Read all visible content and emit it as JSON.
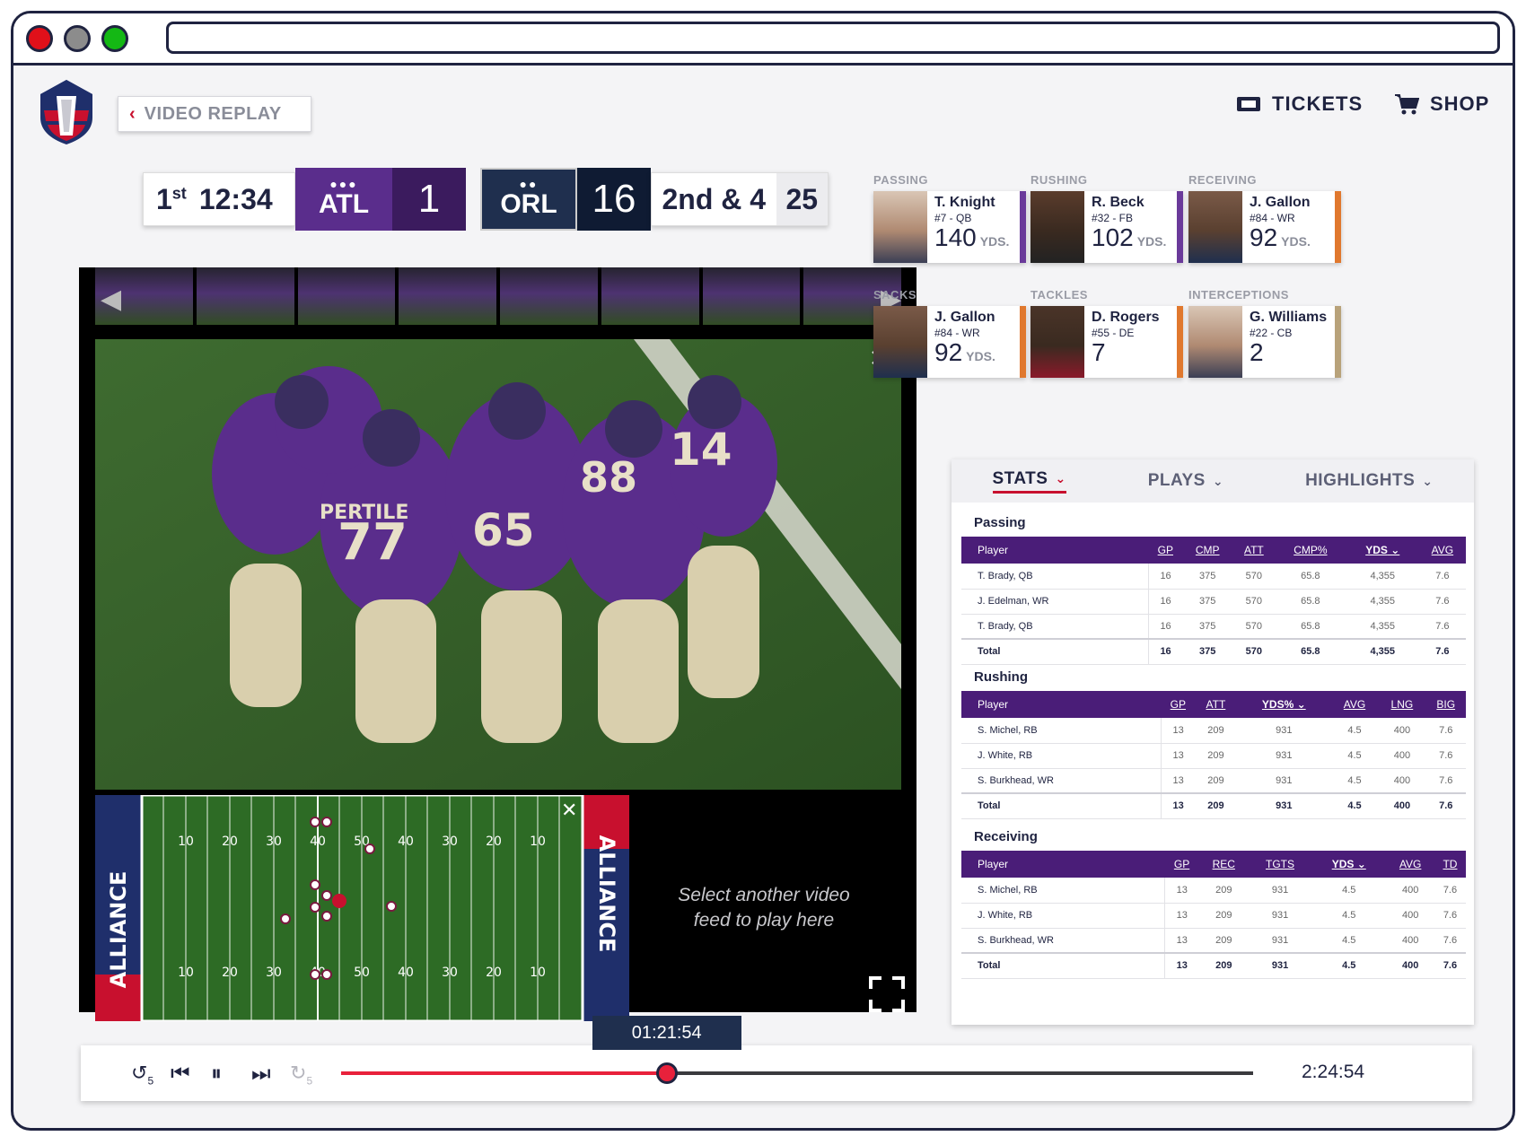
{
  "header": {
    "back_label": "VIDEO REPLAY",
    "nav": [
      {
        "label": "TICKETS",
        "icon": "ticket-icon"
      },
      {
        "label": "SHOP",
        "icon": "cart-icon"
      }
    ]
  },
  "scoreboard": {
    "quarter": "1",
    "quarter_suffix": "st",
    "clock": "12:34",
    "home": {
      "abbr": "ATL",
      "score": "1",
      "color": "#5a2d8c",
      "score_bg": "#3b1b5e"
    },
    "away": {
      "abbr": "ORL",
      "score": "16",
      "color": "#1f2f4e",
      "score_bg": "#0f1b33"
    },
    "down": "2nd & 4",
    "yardline": "25"
  },
  "video": {
    "main_alt": "Team huddle on the field",
    "huddle_numbers": [
      "77",
      "65",
      "14",
      "88"
    ],
    "huddle_name": "PERTILE",
    "field_side_label": "ALLIANCE",
    "yard_numbers": [
      "10",
      "20",
      "30",
      "40",
      "50",
      "40",
      "30",
      "20",
      "10"
    ],
    "secondary_placeholder": "Select another video feed to play here"
  },
  "leaders": [
    {
      "category": "PASSING",
      "name": "T. Knight",
      "pos": "#7 - QB",
      "value": "140",
      "unit": "YDS.",
      "stripe": "#6a3a9a"
    },
    {
      "category": "RUSHING",
      "name": "R. Beck",
      "pos": "#32 - FB",
      "value": "102",
      "unit": "YDS.",
      "stripe": "#6a3a9a"
    },
    {
      "category": "RECEIVING",
      "name": "J. Gallon",
      "pos": "#84 - WR",
      "value": "92",
      "unit": "YDS.",
      "stripe": "#e0782e"
    },
    {
      "category": "SACKS",
      "name": "J. Gallon",
      "pos": "#84 - WR",
      "value": "92",
      "unit": "YDS.",
      "stripe": "#e0782e"
    },
    {
      "category": "TACKLES",
      "name": "D. Rogers",
      "pos": "#55 - DE",
      "value": "7",
      "unit": "",
      "stripe": "#e0782e"
    },
    {
      "category": "INTERCEPTIONS",
      "name": "G. Williams",
      "pos": "#22 - CB",
      "value": "2",
      "unit": "",
      "stripe": "#b8a27a"
    }
  ],
  "tabs": [
    {
      "label": "STATS",
      "active": true
    },
    {
      "label": "PLAYS",
      "active": false
    },
    {
      "label": "HIGHLIGHTS",
      "active": false
    }
  ],
  "tables": [
    {
      "title": "Passing",
      "columns": [
        "Player",
        "GP",
        "CMP",
        "ATT",
        "CMP%",
        "YDS",
        "AVG"
      ],
      "sorted": "YDS",
      "rows": [
        [
          "T. Brady, QB",
          "16",
          "375",
          "570",
          "65.8",
          "4,355",
          "7.6"
        ],
        [
          "J. Edelman, WR",
          "16",
          "375",
          "570",
          "65.8",
          "4,355",
          "7.6"
        ],
        [
          "T. Brady, QB",
          "16",
          "375",
          "570",
          "65.8",
          "4,355",
          "7.6"
        ]
      ],
      "total": [
        "Total",
        "16",
        "375",
        "570",
        "65.8",
        "4,355",
        "7.6"
      ]
    },
    {
      "title": "Rushing",
      "columns": [
        "Player",
        "GP",
        "ATT",
        "YDS%",
        "AVG",
        "LNG",
        "BIG"
      ],
      "sorted": "YDS%",
      "rows": [
        [
          "S. Michel, RB",
          "13",
          "209",
          "931",
          "4.5",
          "400",
          "7.6"
        ],
        [
          "J. White, RB",
          "13",
          "209",
          "931",
          "4.5",
          "400",
          "7.6"
        ],
        [
          "S. Burkhead, WR",
          "13",
          "209",
          "931",
          "4.5",
          "400",
          "7.6"
        ]
      ],
      "total": [
        "Total",
        "13",
        "209",
        "931",
        "4.5",
        "400",
        "7.6"
      ]
    },
    {
      "title": "Receiving",
      "columns": [
        "Player",
        "GP",
        "REC",
        "TGTS",
        "YDS",
        "AVG",
        "TD"
      ],
      "sorted": "YDS",
      "rows": [
        [
          "S. Michel, RB",
          "13",
          "209",
          "931",
          "4.5",
          "400",
          "7.6"
        ],
        [
          "J. White, RB",
          "13",
          "209",
          "931",
          "4.5",
          "400",
          "7.6"
        ],
        [
          "S. Burkhead, WR",
          "13",
          "209",
          "931",
          "4.5",
          "400",
          "7.6"
        ]
      ],
      "total": [
        "Total",
        "13",
        "209",
        "931",
        "4.5",
        "400",
        "7.6"
      ]
    }
  ],
  "player": {
    "current_time": "01:21:54",
    "duration": "2:24:54",
    "progress": 0.357,
    "rewind_label": "5",
    "forward_label": "5",
    "accent": "#e8213b"
  },
  "colors": {
    "navy": "#1f2340",
    "red": "#c8102e",
    "purple": "#4a1d78"
  }
}
